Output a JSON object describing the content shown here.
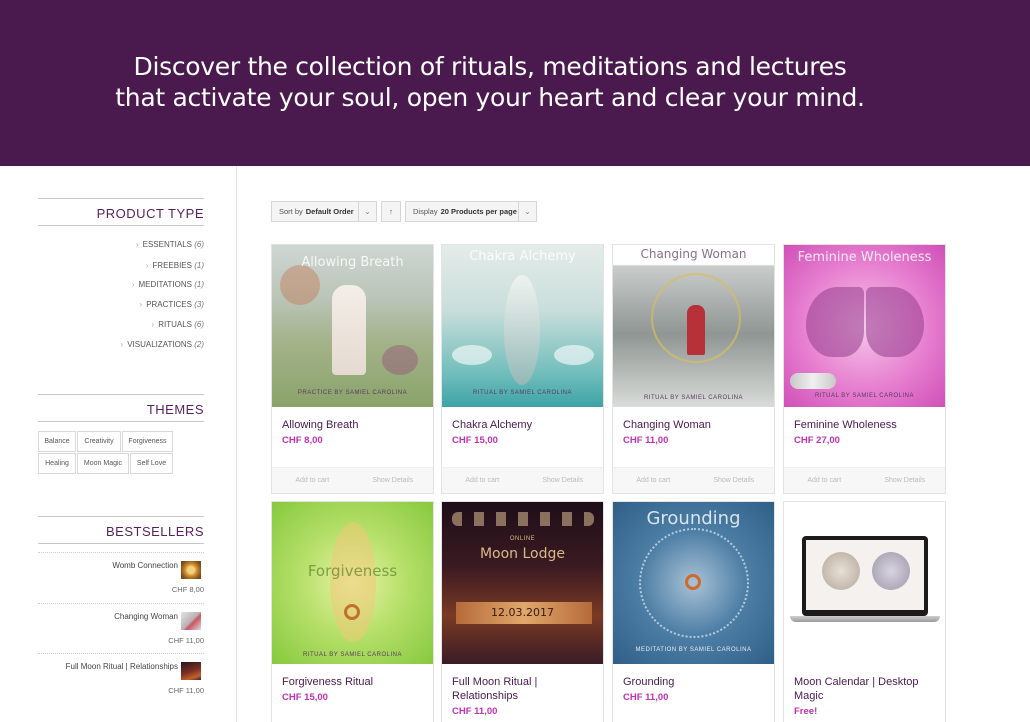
{
  "hero": {
    "line1": "Discover the collection of rituals, meditations and lectures",
    "line2": "that activate your soul, open your heart and clear your mind."
  },
  "sidebar": {
    "product_type": {
      "title": "PRODUCT TYPE",
      "items": [
        {
          "label": "ESSENTIALS",
          "count": "(6)"
        },
        {
          "label": "FREEBIES",
          "count": "(1)"
        },
        {
          "label": "MEDITATIONS",
          "count": "(1)"
        },
        {
          "label": "PRACTICES",
          "count": "(3)"
        },
        {
          "label": "RITUALS",
          "count": "(6)"
        },
        {
          "label": "VISUALIZATIONS",
          "count": "(2)"
        }
      ]
    },
    "themes": {
      "title": "THEMES",
      "tags": [
        "Balance",
        "Creativity",
        "Forgiveness",
        "Healing",
        "Moon Magic",
        "Self Love"
      ]
    },
    "bestsellers": {
      "title": "BESTSELLERS",
      "items": [
        {
          "name": "Womb Connection",
          "price": "CHF 8,00"
        },
        {
          "name": "Changing Woman",
          "price": "CHF 11,00"
        },
        {
          "name": "Full Moon Ritual | Relationships",
          "price": "CHF 11,00"
        }
      ]
    }
  },
  "toolbar": {
    "sort_prefix": "Sort by",
    "sort_value": "Default Order",
    "dir_icon": "↑",
    "display_prefix": "Display",
    "display_value": "20 Products per page"
  },
  "products": [
    {
      "title": "Allowing Breath",
      "price": "CHF 8,00",
      "image_title": "Allowing Breath",
      "image_footer": "PRACTICE BY SAMIEL CAROLINA",
      "add_to_cart": "Add to cart",
      "details": "Show Details"
    },
    {
      "title": "Chakra Alchemy",
      "price": "CHF 15,00",
      "image_title": "Chakra Alchemy",
      "image_footer": "RITUAL BY SAMIEL CAROLINA",
      "add_to_cart": "Add to cart",
      "details": "Show Details"
    },
    {
      "title": "Changing Woman",
      "price": "CHF 11,00",
      "image_title": "Changing Woman",
      "image_footer": "RITUAL BY SAMIEL CAROLINA",
      "add_to_cart": "Add to cart",
      "details": "Show Details"
    },
    {
      "title": "Feminine Wholeness",
      "price": "CHF 27,00",
      "image_title": "Feminine Wholeness",
      "image_footer": "RITUAL BY SAMIEL CAROLINA",
      "add_to_cart": "Add to cart",
      "details": "Show Details"
    },
    {
      "title": "Forgiveness Ritual",
      "price": "CHF 15,00",
      "image_title": "Forgiveness",
      "image_footer": "RITUAL BY SAMIEL CAROLINA"
    },
    {
      "title": "Full Moon Ritual | Relationships",
      "price": "CHF 11,00",
      "image_title": "Moon Lodge",
      "image_date": "12.03.2017",
      "image_footer": "ONLINE"
    },
    {
      "title": "Grounding",
      "price": "CHF 11,00",
      "image_title": "Grounding",
      "image_footer": "MEDITATION BY SAMIEL CAROLINA"
    },
    {
      "title": "Moon Calendar | Desktop Magic",
      "price": "Free!"
    }
  ],
  "colors": {
    "hero_bg": "#4a1a4f",
    "accent_title": "#4a1a4f",
    "price": "#c231b4"
  }
}
